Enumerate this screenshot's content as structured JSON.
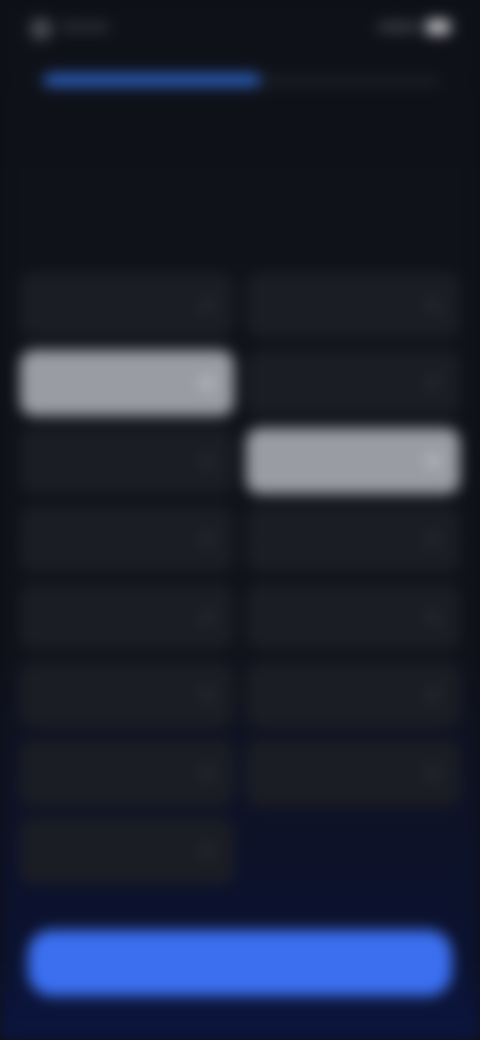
{
  "progress": {
    "value": 0.55
  },
  "heading": {
    "text": ""
  },
  "options": {
    "left": [
      {
        "label": "",
        "selected": false
      },
      {
        "label": "",
        "selected": true
      },
      {
        "label": "",
        "selected": false
      },
      {
        "label": "",
        "selected": false
      },
      {
        "label": "",
        "selected": false
      },
      {
        "label": "",
        "selected": false
      },
      {
        "label": "",
        "selected": false
      },
      {
        "label": "",
        "selected": false
      }
    ],
    "right": [
      {
        "label": "",
        "selected": false
      },
      {
        "label": "",
        "selected": false
      },
      {
        "label": "",
        "selected": true
      },
      {
        "label": "",
        "selected": false
      },
      {
        "label": "",
        "selected": false
      },
      {
        "label": "",
        "selected": false
      },
      {
        "label": "",
        "selected": false
      }
    ]
  },
  "cta": {
    "label": ""
  },
  "colors": {
    "background": "#0e1017",
    "tile": "#1b1d24",
    "tile_selected": "#9a9ca3",
    "accent": "#3b6ff0",
    "progress": "#2d63c8"
  }
}
